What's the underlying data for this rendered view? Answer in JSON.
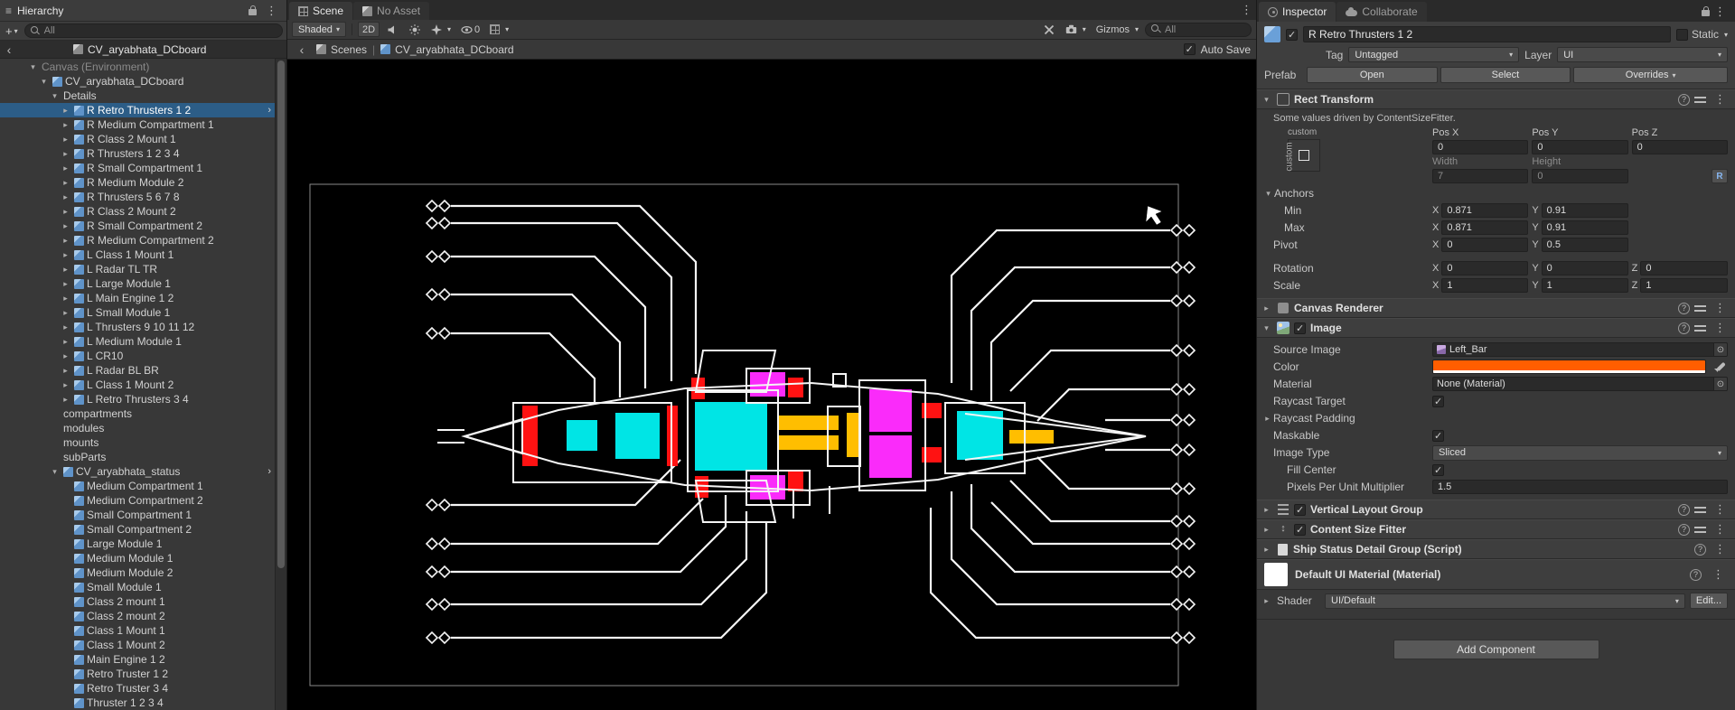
{
  "colors": {
    "selection": "#2C5D87",
    "part_red": "#FF1212",
    "part_cyan": "#00E5E5",
    "part_magenta": "#FA2BFA",
    "part_yellow": "#FFBE00",
    "image_color_value": "#FF5E00",
    "ship_outline": "#F5F5F5"
  },
  "hierarchy": {
    "title": "Hierarchy",
    "create_button": "+",
    "search_placeholder": "All",
    "prefab_header": "CV_aryabhata_DCboard",
    "items": [
      {
        "label": "Canvas (Environment)",
        "depth": 0,
        "fold": "open",
        "icon": false,
        "dim": true
      },
      {
        "label": "CV_aryabhata_DCboard",
        "depth": 1,
        "fold": "open",
        "icon": true
      },
      {
        "label": "Details",
        "depth": 2,
        "fold": "open",
        "icon": false
      },
      {
        "label": "R Retro Thrusters 1 2",
        "depth": 3,
        "fold": "closed",
        "icon": true,
        "sel": true,
        "nav": true
      },
      {
        "label": "R Medium Compartment 1",
        "depth": 3,
        "fold": "closed",
        "icon": true
      },
      {
        "label": "R Class 2 Mount 1",
        "depth": 3,
        "fold": "closed",
        "icon": true
      },
      {
        "label": "R Thrusters 1 2 3 4",
        "depth": 3,
        "fold": "closed",
        "icon": true
      },
      {
        "label": "R Small Compartment 1",
        "depth": 3,
        "fold": "closed",
        "icon": true
      },
      {
        "label": "R Medium Module 2",
        "depth": 3,
        "fold": "closed",
        "icon": true
      },
      {
        "label": "R Thrusters 5 6 7 8",
        "depth": 3,
        "fold": "closed",
        "icon": true
      },
      {
        "label": "R Class 2 Mount 2",
        "depth": 3,
        "fold": "closed",
        "icon": true
      },
      {
        "label": "R Small Compartment 2",
        "depth": 3,
        "fold": "closed",
        "icon": true
      },
      {
        "label": "R Medium Compartment 2",
        "depth": 3,
        "fold": "closed",
        "icon": true
      },
      {
        "label": "L Class 1 Mount 1",
        "depth": 3,
        "fold": "closed",
        "icon": true
      },
      {
        "label": "L Radar TL TR",
        "depth": 3,
        "fold": "closed",
        "icon": true
      },
      {
        "label": "L Large Module 1",
        "depth": 3,
        "fold": "closed",
        "icon": true
      },
      {
        "label": "L Main Engine 1 2",
        "depth": 3,
        "fold": "closed",
        "icon": true
      },
      {
        "label": "L Small Module 1",
        "depth": 3,
        "fold": "closed",
        "icon": true
      },
      {
        "label": "L Thrusters 9 10 11 12",
        "depth": 3,
        "fold": "closed",
        "icon": true
      },
      {
        "label": "L Medium Module 1",
        "depth": 3,
        "fold": "closed",
        "icon": true
      },
      {
        "label": "L CR10",
        "depth": 3,
        "fold": "closed",
        "icon": true
      },
      {
        "label": "L Radar BL BR",
        "depth": 3,
        "fold": "closed",
        "icon": true
      },
      {
        "label": "L Class 1 Mount 2",
        "depth": 3,
        "fold": "closed",
        "icon": true
      },
      {
        "label": "L Retro Thrusters 3 4",
        "depth": 3,
        "fold": "closed",
        "icon": true
      },
      {
        "label": "compartments",
        "depth": 2,
        "fold": "",
        "icon": false
      },
      {
        "label": "modules",
        "depth": 2,
        "fold": "",
        "icon": false
      },
      {
        "label": "mounts",
        "depth": 2,
        "fold": "",
        "icon": false
      },
      {
        "label": "subParts",
        "depth": 2,
        "fold": "",
        "icon": false
      },
      {
        "label": "CV_aryabhata_status",
        "depth": 2,
        "fold": "open",
        "icon": true,
        "nav": true
      },
      {
        "label": "Medium Compartment 1",
        "depth": 3,
        "fold": "",
        "icon": true
      },
      {
        "label": "Medium Compartment 2",
        "depth": 3,
        "fold": "",
        "icon": true
      },
      {
        "label": "Small Compartment 1",
        "depth": 3,
        "fold": "",
        "icon": true
      },
      {
        "label": "Small Compartment 2",
        "depth": 3,
        "fold": "",
        "icon": true
      },
      {
        "label": "Large Module 1",
        "depth": 3,
        "fold": "",
        "icon": true
      },
      {
        "label": "Medium Module 1",
        "depth": 3,
        "fold": "",
        "icon": true
      },
      {
        "label": "Medium Module 2",
        "depth": 3,
        "fold": "",
        "icon": true
      },
      {
        "label": "Small Module 1",
        "depth": 3,
        "fold": "",
        "icon": true
      },
      {
        "label": "Class 2 mount 1",
        "depth": 3,
        "fold": "",
        "icon": true
      },
      {
        "label": "Class 2 mount 2",
        "depth": 3,
        "fold": "",
        "icon": true
      },
      {
        "label": "Class 1 Mount 1",
        "depth": 3,
        "fold": "",
        "icon": true
      },
      {
        "label": "Class 1 Mount 2",
        "depth": 3,
        "fold": "",
        "icon": true
      },
      {
        "label": "Main Engine 1 2",
        "depth": 3,
        "fold": "",
        "icon": true
      },
      {
        "label": "Retro Truster 1 2",
        "depth": 3,
        "fold": "",
        "icon": true
      },
      {
        "label": "Retro Truster 3 4",
        "depth": 3,
        "fold": "",
        "icon": true
      },
      {
        "label": "Thruster 1 2 3 4",
        "depth": 3,
        "fold": "",
        "icon": true
      }
    ]
  },
  "scene_view": {
    "tab_scene": "Scene",
    "tab_asset": "No Asset",
    "toolbar": {
      "shading_mode": "Shaded",
      "mode_2d": "2D",
      "hidden_count": "0",
      "gizmos": "Gizmos",
      "search_placeholder": "All"
    },
    "breadcrumb": {
      "scenes": "Scenes",
      "current": "CV_aryabhata_DCboard",
      "auto_save": "Auto Save"
    }
  },
  "inspector": {
    "tab_inspector": "Inspector",
    "tab_collaborate": "Collaborate",
    "header": {
      "name": "R Retro Thrusters 1 2",
      "static_label": "Static",
      "tag_label": "Tag",
      "tag_value": "Untagged",
      "layer_label": "Layer",
      "layer_value": "UI",
      "prefab_label": "Prefab",
      "open_label": "Open",
      "select_label": "Select",
      "overrides_label": "Overrides"
    },
    "rect_transform": {
      "title": "Rect Transform",
      "driven_note": "Some values driven by ContentSizeFitter.",
      "anchor_preset": "custom",
      "pos_x_label": "Pos X",
      "pos_y_label": "Pos Y",
      "pos_z_label": "Pos Z",
      "pos_x": "0",
      "pos_y": "0",
      "pos_z": "0",
      "width_label": "Width",
      "height_label": "Height",
      "width": "7",
      "height": "0",
      "raw_edit_label": "R",
      "anchors_label": "Anchors",
      "min_label": "Min",
      "max_label": "Max",
      "x_label": "X",
      "y_label": "Y",
      "z_label": "Z",
      "min_x": "0.871",
      "min_y": "0.91",
      "max_x": "0.871",
      "max_y": "0.91",
      "pivot_label": "Pivot",
      "pivot_x": "0",
      "pivot_y": "0.5",
      "rotation_label": "Rotation",
      "rot_x": "0",
      "rot_y": "0",
      "rot_z": "0",
      "scale_label": "Scale",
      "scale_x": "1",
      "scale_y": "1",
      "scale_z": "1"
    },
    "canvas_renderer": {
      "title": "Canvas Renderer"
    },
    "image": {
      "title": "Image",
      "source_image_label": "Source Image",
      "source_image": "Left_Bar",
      "color_label": "Color",
      "material_label": "Material",
      "material": "None (Material)",
      "raycast_target_label": "Raycast Target",
      "raycast_padding_label": "Raycast Padding",
      "maskable_label": "Maskable",
      "image_type_label": "Image Type",
      "image_type": "Sliced",
      "fill_center_label": "Fill Center",
      "ppu_label": "Pixels Per Unit Multiplier",
      "ppu": "1.5"
    },
    "vertical_layout_group": {
      "title": "Vertical Layout Group"
    },
    "content_size_fitter": {
      "title": "Content Size Fitter"
    },
    "ship_status_script": {
      "title": "Ship Status Detail Group (Script)"
    },
    "material_section": {
      "title": "Default UI Material (Material)",
      "shader_label": "Shader",
      "shader": "UI/Default",
      "edit_label": "Edit..."
    },
    "add_component_label": "Add Component"
  }
}
